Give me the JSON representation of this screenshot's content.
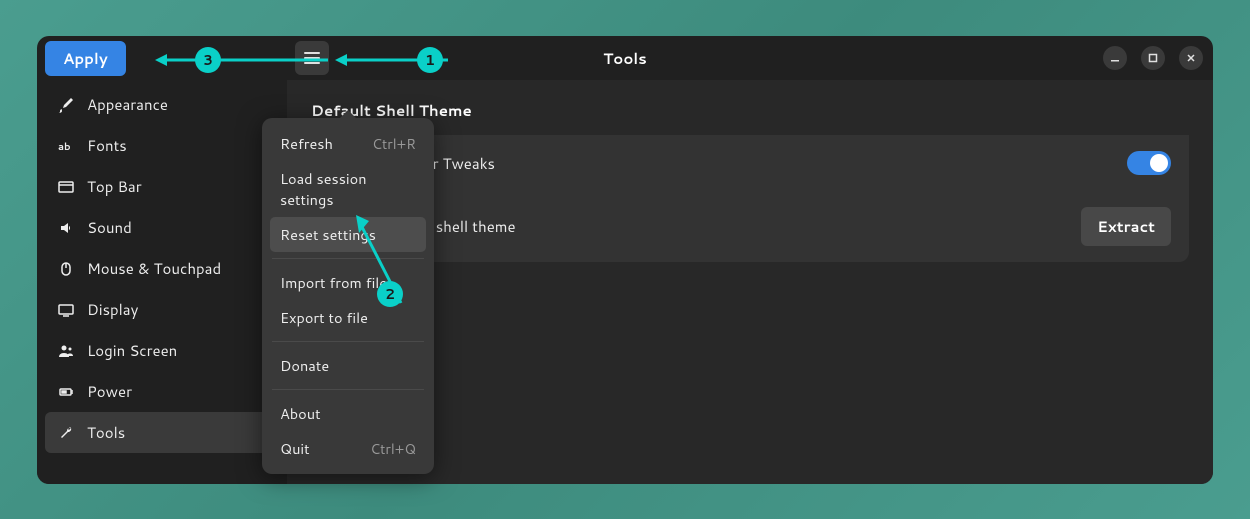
{
  "header": {
    "apply_label": "Apply",
    "title": "Tools"
  },
  "sidebar": {
    "items": [
      {
        "label": "Appearance",
        "icon": "brush"
      },
      {
        "label": "Fonts",
        "icon": "fonts"
      },
      {
        "label": "Top Bar",
        "icon": "topbar"
      },
      {
        "label": "Sound",
        "icon": "sound"
      },
      {
        "label": "Mouse & Touchpad",
        "icon": "mouse"
      },
      {
        "label": "Display",
        "icon": "display"
      },
      {
        "label": "Login Screen",
        "icon": "login"
      },
      {
        "label": "Power",
        "icon": "power"
      },
      {
        "label": "Tools",
        "icon": "tools"
      }
    ],
    "selected_index": 8
  },
  "menu": {
    "items": [
      {
        "label": "Refresh",
        "shortcut": "Ctrl+R"
      },
      {
        "label": "Load session settings",
        "shortcut": ""
      },
      {
        "label": "Reset settings",
        "shortcut": ""
      },
      {
        "label": "Import from file",
        "shortcut": ""
      },
      {
        "label": "Export to file",
        "shortcut": ""
      },
      {
        "label": "Donate",
        "shortcut": ""
      },
      {
        "label": "About",
        "shortcut": ""
      },
      {
        "label": "Quit",
        "shortcut": "Ctrl+Q"
      }
    ],
    "hover_index": 2
  },
  "main": {
    "section_title": "Default Shell Theme",
    "row1_label": "Include Top Bar Tweaks",
    "row1_toggle": true,
    "row2_label": "Extract default shell theme",
    "row2_button": "Extract"
  },
  "annotations": {
    "a1": "1",
    "a2": "2",
    "a3": "3"
  }
}
